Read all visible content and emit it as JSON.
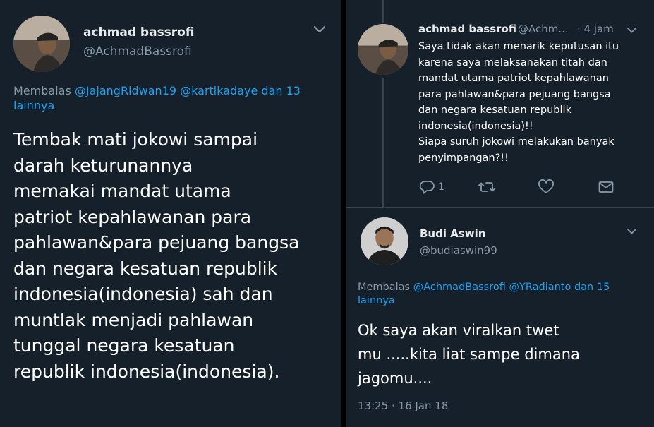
{
  "left_tweet": {
    "author": {
      "name": "achmad bassrofi",
      "handle": "@AchmadBassrofi"
    },
    "reply_to": {
      "prefix": "Membalas",
      "mentions": [
        "@JajangRidwan19",
        "@kartikadaye"
      ],
      "suffix": "dan",
      "others": "13 lainnya"
    },
    "text_lines": [
      "Tembak mati jokowi sampai",
      "darah keturunannya",
      "memakai mandat utama",
      "patriot kepahlawanan para",
      "pahlawan&para pejuang bangsa",
      "dan negara kesatuan republik",
      "indonesia(indonesia) sah dan",
      "muntlak menjadi pahlawan",
      "tunggal negara kesatuan",
      "republik indonesia(indonesia)."
    ]
  },
  "right_panel": {
    "parent_tweet": {
      "author": {
        "name": "achmad bassrofi",
        "handle": "@Achm...",
        "time": "· 4 jam"
      },
      "text_lines": [
        "Saya tidak akan menarik keputusan itu",
        "karena saya melaksanakan titah dan",
        "mandat utama patriot kepahlawanan",
        "para pahlawan&para pejuang bangsa",
        "dan negara kesatuan republik",
        "indonesia(indonesia)!!",
        "Siapa suruh jokowi melakukan banyak",
        "penyimpangan?!!"
      ],
      "actions": {
        "reply_count": "1",
        "icons": [
          "reply-icon",
          "retweet-icon",
          "like-icon",
          "message-icon"
        ]
      }
    },
    "reply_tweet": {
      "author": {
        "name": "Budi Aswin",
        "handle": "@budiaswin99"
      },
      "reply_to": {
        "prefix": "Membalas",
        "mentions": [
          "@AchmadBassrofi",
          "@YRadianto"
        ],
        "suffix": "dan",
        "others": "15 lainnya"
      },
      "text_lines": [
        "Ok saya akan viralkan twet",
        "mu .....kita liat sampe dimana",
        "jagomu...."
      ],
      "timestamp": "13:25 · 16 Jan 18"
    }
  },
  "colors": {
    "background": "#15202b",
    "text": "#ffffff",
    "secondary_text": "#8899a6",
    "link": "#1da1f2",
    "divider": "#38444d"
  }
}
